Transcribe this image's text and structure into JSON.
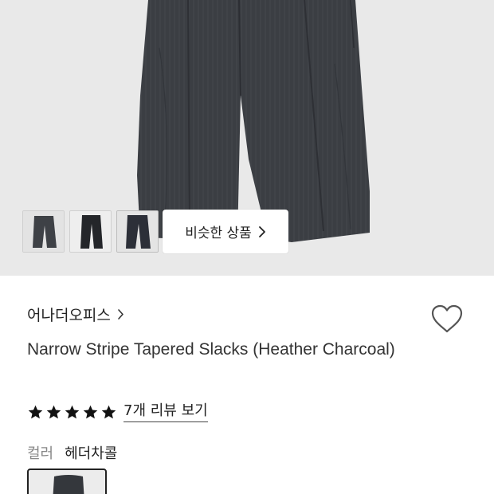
{
  "gallery": {
    "similar_button_label": "비슷한 상품",
    "thumbnails": [
      {
        "name": "thumbnail-1"
      },
      {
        "name": "thumbnail-2"
      },
      {
        "name": "thumbnail-3"
      }
    ]
  },
  "product": {
    "brand": "어나더오피스",
    "title": "Narrow Stripe Tapered Slacks (Heather Charcoal)",
    "rating_stars": 5,
    "review_link": "7개 리뷰 보기",
    "option": {
      "label": "컬러",
      "value": "헤더차콜"
    }
  },
  "colors": {
    "hero_bg": "#e9e9e9",
    "pants": "#3a3d42",
    "star": "#111111"
  },
  "icons": {
    "similar_chevron": "chevron-right-icon",
    "brand_chevron": "chevron-right-icon",
    "wishlist": "heart-outline-icon",
    "star": "star-filled-icon"
  }
}
